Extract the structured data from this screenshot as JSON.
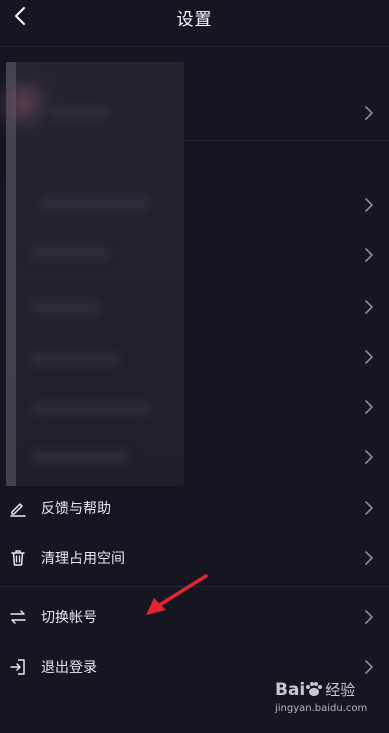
{
  "header": {
    "title": "设置"
  },
  "menu": [
    {
      "label": "反馈与帮助",
      "icon": "edit-icon"
    },
    {
      "label": "清理占用空间",
      "icon": "trash-icon"
    },
    {
      "label": "切换帐号",
      "icon": "switch-icon"
    },
    {
      "label": "退出登录",
      "icon": "logout-icon"
    }
  ],
  "watermark": {
    "brand": "Bai",
    "brand_suffix": "经验",
    "url": "jingyan.baidu.com"
  },
  "colors": {
    "background": "#161622",
    "text": "#e8e8ee",
    "chevron": "#8a8a99",
    "arrow": "#e0262e"
  }
}
